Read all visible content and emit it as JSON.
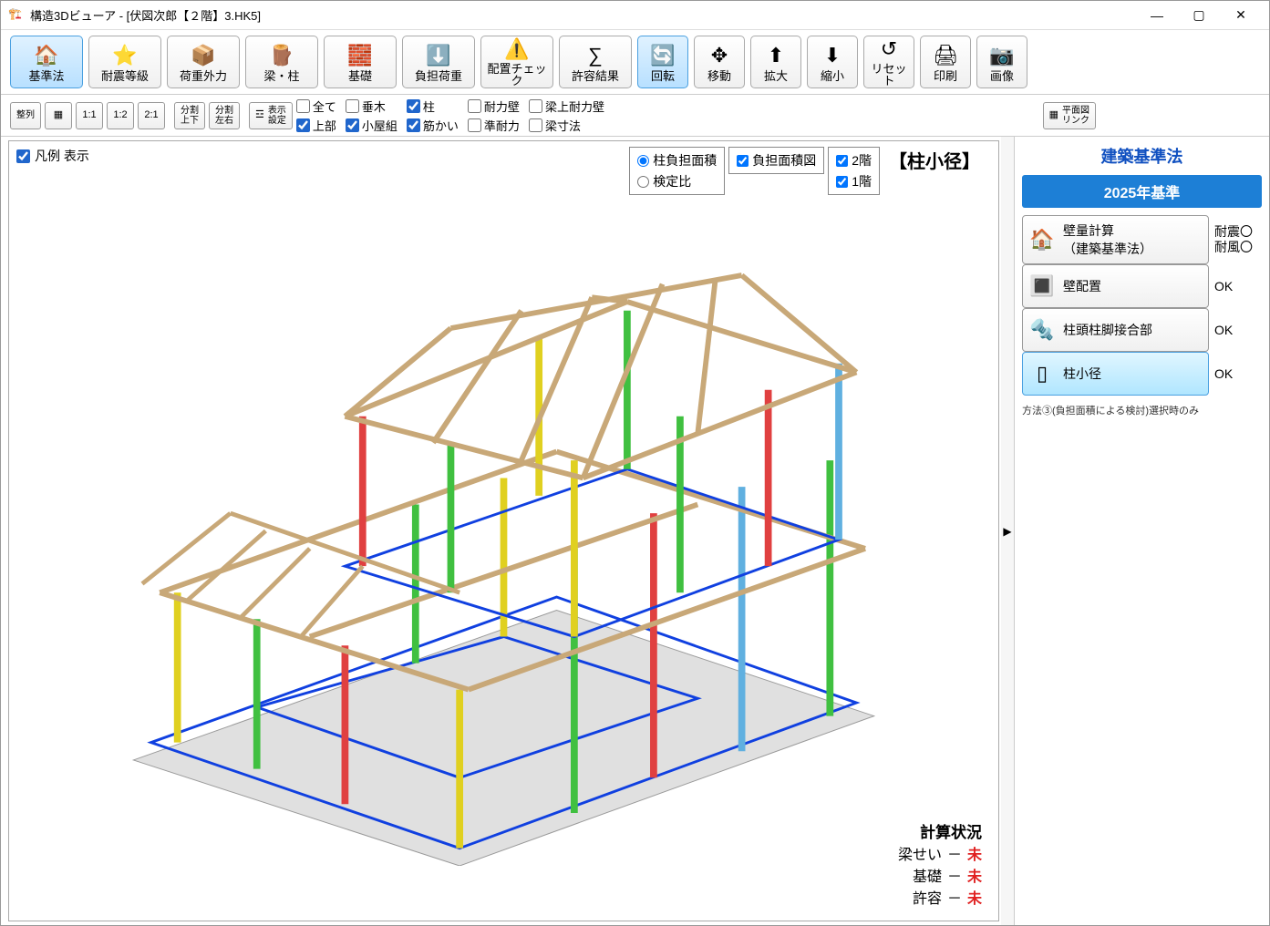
{
  "window": {
    "title": "構造3Dビューア - [伏図次郎【２階】3.HK5]"
  },
  "toolbar": [
    {
      "label": "基準法",
      "icon": "🏠",
      "active": true
    },
    {
      "label": "耐震等級",
      "icon": "⭐"
    },
    {
      "label": "荷重外力",
      "icon": "📦"
    },
    {
      "label": "梁・柱",
      "icon": "🪵"
    },
    {
      "label": "基礎",
      "icon": "🧱"
    },
    {
      "label": "負担荷重",
      "icon": "⬇️"
    },
    {
      "label": "配置チェック",
      "icon": "⚠️"
    },
    {
      "label": "許容結果",
      "icon": "∑"
    },
    {
      "label": "回転",
      "icon": "🔄",
      "active": true,
      "small": true
    },
    {
      "label": "移動",
      "icon": "✥",
      "small": true
    },
    {
      "label": "拡大",
      "icon": "⬆",
      "small": true
    },
    {
      "label": "縮小",
      "icon": "⬇",
      "small": true
    },
    {
      "label": "リセット",
      "icon": "↺",
      "small": true
    },
    {
      "label": "印刷",
      "icon": "🖨",
      "small": true
    },
    {
      "label": "画像",
      "icon": "📷",
      "small": true
    }
  ],
  "sec": {
    "align_label": "整列",
    "ratios": [
      "1:1",
      "1:2",
      "2:1"
    ],
    "split_tb": "分割\n上下",
    "split_lr": "分割\n左右",
    "disp_set": "表示\n設定",
    "checks": [
      {
        "label": "全て",
        "checked": false
      },
      {
        "label": "垂木",
        "checked": false
      },
      {
        "label": "柱",
        "checked": true
      },
      {
        "label": "耐力壁",
        "checked": false
      },
      {
        "label": "梁上耐力壁",
        "checked": false
      },
      {
        "label": "上部",
        "checked": true
      },
      {
        "label": "小屋組",
        "checked": true
      },
      {
        "label": "筋かい",
        "checked": true
      },
      {
        "label": "準耐力",
        "checked": false
      },
      {
        "label": "梁寸法",
        "checked": false
      }
    ],
    "plan_link": "平面図\nリンク"
  },
  "viewport": {
    "legend_label": "凡例 表示",
    "legend_checked": true,
    "title": "【柱小径】",
    "radio_group": [
      {
        "label": "柱負担面積",
        "checked": true
      },
      {
        "label": "検定比",
        "checked": false
      }
    ],
    "area_chk": {
      "label": "負担面積図",
      "checked": true
    },
    "floors": [
      {
        "label": "2階",
        "checked": true
      },
      {
        "label": "1階",
        "checked": true
      }
    ],
    "status": {
      "title": "計算状況",
      "rows": [
        {
          "name": "梁せい",
          "sep": "－",
          "val": "未"
        },
        {
          "name": "基礎",
          "sep": "－",
          "val": "未"
        },
        {
          "name": "許容",
          "sep": "－",
          "val": "未"
        }
      ]
    }
  },
  "rpanel": {
    "title": "建築基準法",
    "badge": "2025年基準",
    "items": [
      {
        "label": "壁量計算\n（建築基準法）",
        "status": "耐震〇\n耐風〇",
        "icon": "🏠"
      },
      {
        "label": "壁配置",
        "status": "OK",
        "icon": "🔳"
      },
      {
        "label": "柱頭柱脚接合部",
        "status": "OK",
        "icon": "🔩"
      },
      {
        "label": "柱小径",
        "status": "OK",
        "icon": "▯",
        "active": true
      }
    ],
    "note": "方法③(負担面積による検討)選択時のみ"
  }
}
